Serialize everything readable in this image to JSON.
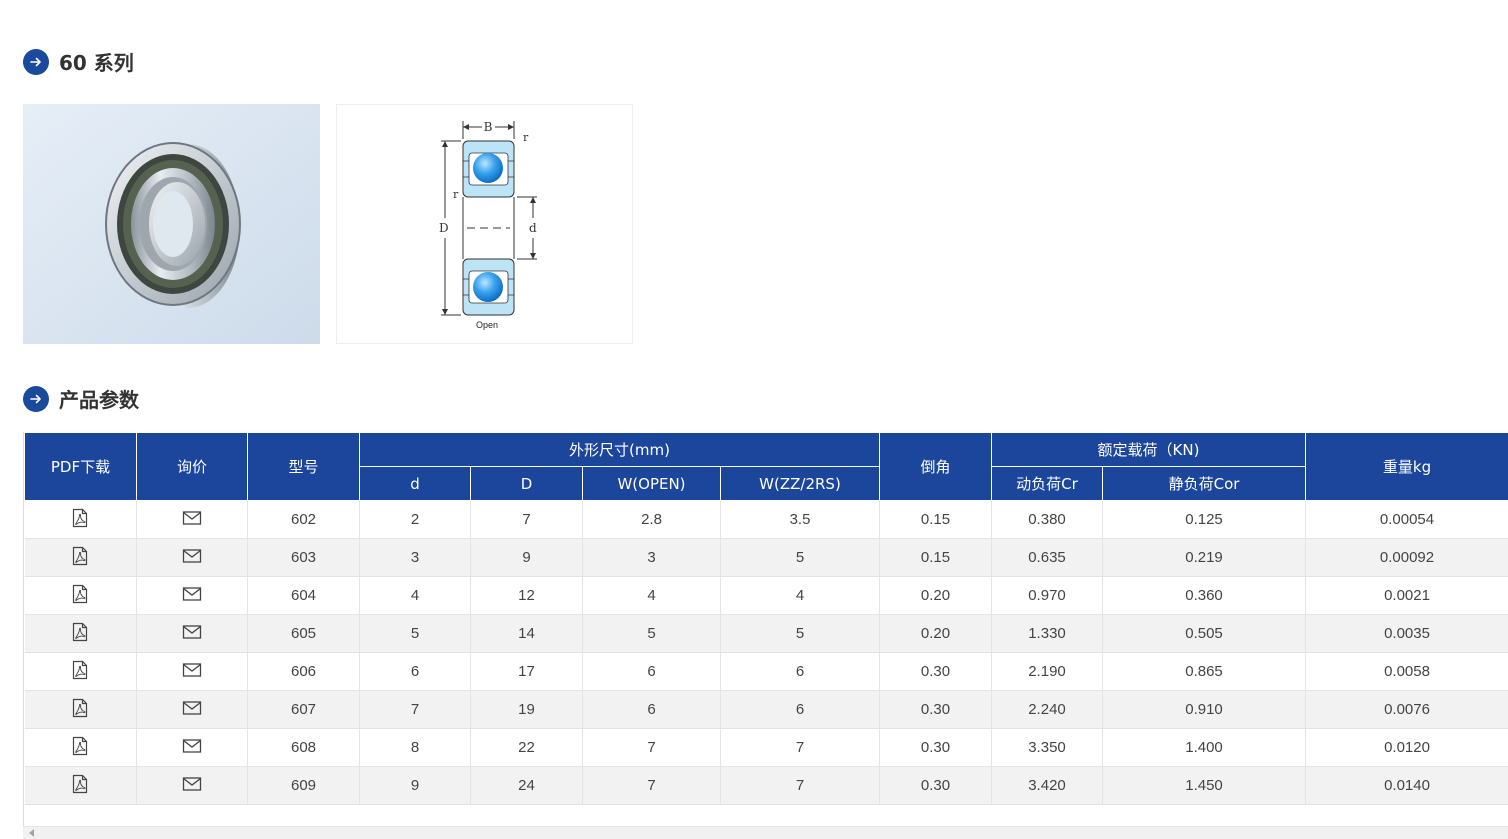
{
  "sections": {
    "series_title": "60 系列",
    "params_title": "产品参数"
  },
  "diagram": {
    "label_B": "B",
    "label_r_top": "r",
    "label_r_left": "r",
    "label_D": "D",
    "label_d": "d",
    "caption": "Open"
  },
  "table": {
    "headers": {
      "pdf": "PDF下载",
      "inquiry": "询价",
      "model": "型号",
      "dimensions": "外形尺寸(mm)",
      "d": "d",
      "D": "D",
      "w_open": "W(OPEN)",
      "w_zz": "W(ZZ/2RS)",
      "chamfer": "倒角",
      "rated_load": "额定载荷（KN)",
      "cr": "动负荷Cr",
      "cor": "静负荷Cor",
      "weight": "重量kg"
    },
    "rows": [
      [
        "602",
        "2",
        "7",
        "2.8",
        "3.5",
        "0.15",
        "0.380",
        "0.125",
        "0.00054"
      ],
      [
        "603",
        "3",
        "9",
        "3",
        "5",
        "0.15",
        "0.635",
        "0.219",
        "0.00092"
      ],
      [
        "604",
        "4",
        "12",
        "4",
        "4",
        "0.20",
        "0.970",
        "0.360",
        "0.0021"
      ],
      [
        "605",
        "5",
        "14",
        "5",
        "5",
        "0.20",
        "1.330",
        "0.505",
        "0.0035"
      ],
      [
        "606",
        "6",
        "17",
        "6",
        "6",
        "0.30",
        "2.190",
        "0.865",
        "0.0058"
      ],
      [
        "607",
        "7",
        "19",
        "6",
        "6",
        "0.30",
        "2.240",
        "0.910",
        "0.0076"
      ],
      [
        "608",
        "8",
        "22",
        "7",
        "7",
        "0.30",
        "3.350",
        "1.400",
        "0.0120"
      ],
      [
        "609",
        "9",
        "24",
        "7",
        "7",
        "0.30",
        "3.420",
        "1.450",
        "0.0140"
      ]
    ]
  },
  "icons": {
    "section": "arrow-right-circle-icon",
    "pdf": "pdf-file-icon",
    "inquiry": "envelope-icon"
  },
  "colors": {
    "accent": "#1b469c",
    "header_text": "#ffffff",
    "row_alt": "#f2f2f2"
  }
}
